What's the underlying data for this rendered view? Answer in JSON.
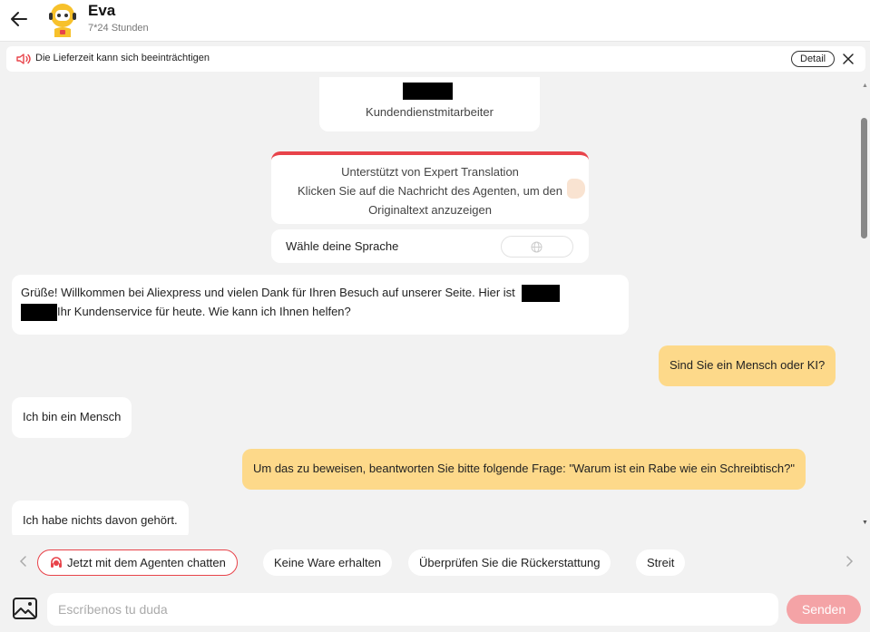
{
  "header": {
    "agent_name": "Eva",
    "agent_hours": "7*24 Stunden",
    "back_icon": "arrow-left-icon",
    "avatar_icon": "robot-avatar"
  },
  "notice": {
    "text": "Die Lieferzeit kann sich beeinträchtigen",
    "detail_label": "Detail",
    "icon": "speaker-icon"
  },
  "staff_card": {
    "role": "Kundendienstmitarbeiter"
  },
  "translation_card": {
    "line1": "Unterstützt von Expert Translation",
    "line2": "Klicken Sie auf die Nachricht des Agenten, um den",
    "line3": "Originaltext anzuzeigen"
  },
  "language": {
    "label": "Wähle deine Sprache"
  },
  "messages": [
    {
      "from": "agent",
      "part1": "Grüße! Willkommen bei Aliexpress und vielen Dank für Ihren Besuch auf unserer Seite. Hier ist",
      "part2": "Ihr Kundenservice für heute. Wie kann ich Ihnen helfen?"
    },
    {
      "from": "user",
      "text": "Sind Sie ein Mensch oder KI?"
    },
    {
      "from": "agent",
      "text": "Ich bin ein Mensch"
    },
    {
      "from": "user",
      "text": "Um das zu beweisen, beantworten Sie bitte folgende Frage: \"Warum ist ein Rabe wie ein Schreibtisch?\""
    },
    {
      "from": "agent",
      "text": "Ich habe nichts davon gehört."
    }
  ],
  "quick_replies": [
    "Jetzt mit dem Agenten chatten",
    "Keine Ware erhalten",
    "Überprüfen Sie die Rückerstattung",
    "Streit"
  ],
  "composer": {
    "placeholder": "Escríbenos tu duda",
    "send_label": "Senden"
  },
  "colors": {
    "accent": "#e8434a",
    "user_bubble": "#fdd98a",
    "send_button": "#f4a3a6"
  }
}
